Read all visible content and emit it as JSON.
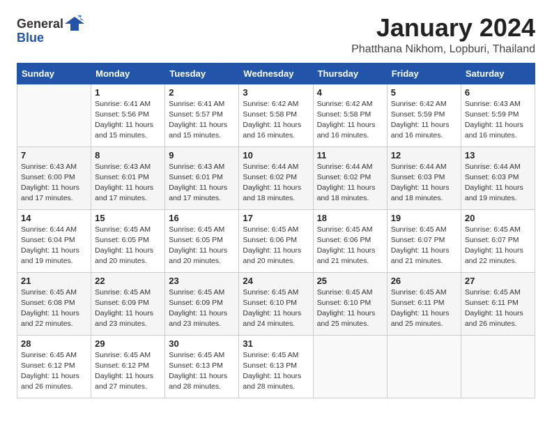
{
  "header": {
    "logo": {
      "text_general": "General",
      "text_blue": "Blue"
    },
    "title": "January 2024",
    "subtitle": "Phatthana Nikhom, Lopburi, Thailand"
  },
  "weekdays": [
    "Sunday",
    "Monday",
    "Tuesday",
    "Wednesday",
    "Thursday",
    "Friday",
    "Saturday"
  ],
  "weeks": [
    [
      {
        "day": "",
        "sunrise": "",
        "sunset": "",
        "daylight": ""
      },
      {
        "day": "1",
        "sunrise": "Sunrise: 6:41 AM",
        "sunset": "Sunset: 5:56 PM",
        "daylight": "Daylight: 11 hours and 15 minutes."
      },
      {
        "day": "2",
        "sunrise": "Sunrise: 6:41 AM",
        "sunset": "Sunset: 5:57 PM",
        "daylight": "Daylight: 11 hours and 15 minutes."
      },
      {
        "day": "3",
        "sunrise": "Sunrise: 6:42 AM",
        "sunset": "Sunset: 5:58 PM",
        "daylight": "Daylight: 11 hours and 16 minutes."
      },
      {
        "day": "4",
        "sunrise": "Sunrise: 6:42 AM",
        "sunset": "Sunset: 5:58 PM",
        "daylight": "Daylight: 11 hours and 16 minutes."
      },
      {
        "day": "5",
        "sunrise": "Sunrise: 6:42 AM",
        "sunset": "Sunset: 5:59 PM",
        "daylight": "Daylight: 11 hours and 16 minutes."
      },
      {
        "day": "6",
        "sunrise": "Sunrise: 6:43 AM",
        "sunset": "Sunset: 5:59 PM",
        "daylight": "Daylight: 11 hours and 16 minutes."
      }
    ],
    [
      {
        "day": "7",
        "sunrise": "Sunrise: 6:43 AM",
        "sunset": "Sunset: 6:00 PM",
        "daylight": "Daylight: 11 hours and 17 minutes."
      },
      {
        "day": "8",
        "sunrise": "Sunrise: 6:43 AM",
        "sunset": "Sunset: 6:01 PM",
        "daylight": "Daylight: 11 hours and 17 minutes."
      },
      {
        "day": "9",
        "sunrise": "Sunrise: 6:43 AM",
        "sunset": "Sunset: 6:01 PM",
        "daylight": "Daylight: 11 hours and 17 minutes."
      },
      {
        "day": "10",
        "sunrise": "Sunrise: 6:44 AM",
        "sunset": "Sunset: 6:02 PM",
        "daylight": "Daylight: 11 hours and 18 minutes."
      },
      {
        "day": "11",
        "sunrise": "Sunrise: 6:44 AM",
        "sunset": "Sunset: 6:02 PM",
        "daylight": "Daylight: 11 hours and 18 minutes."
      },
      {
        "day": "12",
        "sunrise": "Sunrise: 6:44 AM",
        "sunset": "Sunset: 6:03 PM",
        "daylight": "Daylight: 11 hours and 18 minutes."
      },
      {
        "day": "13",
        "sunrise": "Sunrise: 6:44 AM",
        "sunset": "Sunset: 6:03 PM",
        "daylight": "Daylight: 11 hours and 19 minutes."
      }
    ],
    [
      {
        "day": "14",
        "sunrise": "Sunrise: 6:44 AM",
        "sunset": "Sunset: 6:04 PM",
        "daylight": "Daylight: 11 hours and 19 minutes."
      },
      {
        "day": "15",
        "sunrise": "Sunrise: 6:45 AM",
        "sunset": "Sunset: 6:05 PM",
        "daylight": "Daylight: 11 hours and 20 minutes."
      },
      {
        "day": "16",
        "sunrise": "Sunrise: 6:45 AM",
        "sunset": "Sunset: 6:05 PM",
        "daylight": "Daylight: 11 hours and 20 minutes."
      },
      {
        "day": "17",
        "sunrise": "Sunrise: 6:45 AM",
        "sunset": "Sunset: 6:06 PM",
        "daylight": "Daylight: 11 hours and 20 minutes."
      },
      {
        "day": "18",
        "sunrise": "Sunrise: 6:45 AM",
        "sunset": "Sunset: 6:06 PM",
        "daylight": "Daylight: 11 hours and 21 minutes."
      },
      {
        "day": "19",
        "sunrise": "Sunrise: 6:45 AM",
        "sunset": "Sunset: 6:07 PM",
        "daylight": "Daylight: 11 hours and 21 minutes."
      },
      {
        "day": "20",
        "sunrise": "Sunrise: 6:45 AM",
        "sunset": "Sunset: 6:07 PM",
        "daylight": "Daylight: 11 hours and 22 minutes."
      }
    ],
    [
      {
        "day": "21",
        "sunrise": "Sunrise: 6:45 AM",
        "sunset": "Sunset: 6:08 PM",
        "daylight": "Daylight: 11 hours and 22 minutes."
      },
      {
        "day": "22",
        "sunrise": "Sunrise: 6:45 AM",
        "sunset": "Sunset: 6:09 PM",
        "daylight": "Daylight: 11 hours and 23 minutes."
      },
      {
        "day": "23",
        "sunrise": "Sunrise: 6:45 AM",
        "sunset": "Sunset: 6:09 PM",
        "daylight": "Daylight: 11 hours and 23 minutes."
      },
      {
        "day": "24",
        "sunrise": "Sunrise: 6:45 AM",
        "sunset": "Sunset: 6:10 PM",
        "daylight": "Daylight: 11 hours and 24 minutes."
      },
      {
        "day": "25",
        "sunrise": "Sunrise: 6:45 AM",
        "sunset": "Sunset: 6:10 PM",
        "daylight": "Daylight: 11 hours and 25 minutes."
      },
      {
        "day": "26",
        "sunrise": "Sunrise: 6:45 AM",
        "sunset": "Sunset: 6:11 PM",
        "daylight": "Daylight: 11 hours and 25 minutes."
      },
      {
        "day": "27",
        "sunrise": "Sunrise: 6:45 AM",
        "sunset": "Sunset: 6:11 PM",
        "daylight": "Daylight: 11 hours and 26 minutes."
      }
    ],
    [
      {
        "day": "28",
        "sunrise": "Sunrise: 6:45 AM",
        "sunset": "Sunset: 6:12 PM",
        "daylight": "Daylight: 11 hours and 26 minutes."
      },
      {
        "day": "29",
        "sunrise": "Sunrise: 6:45 AM",
        "sunset": "Sunset: 6:12 PM",
        "daylight": "Daylight: 11 hours and 27 minutes."
      },
      {
        "day": "30",
        "sunrise": "Sunrise: 6:45 AM",
        "sunset": "Sunset: 6:13 PM",
        "daylight": "Daylight: 11 hours and 28 minutes."
      },
      {
        "day": "31",
        "sunrise": "Sunrise: 6:45 AM",
        "sunset": "Sunset: 6:13 PM",
        "daylight": "Daylight: 11 hours and 28 minutes."
      },
      {
        "day": "",
        "sunrise": "",
        "sunset": "",
        "daylight": ""
      },
      {
        "day": "",
        "sunrise": "",
        "sunset": "",
        "daylight": ""
      },
      {
        "day": "",
        "sunrise": "",
        "sunset": "",
        "daylight": ""
      }
    ]
  ]
}
